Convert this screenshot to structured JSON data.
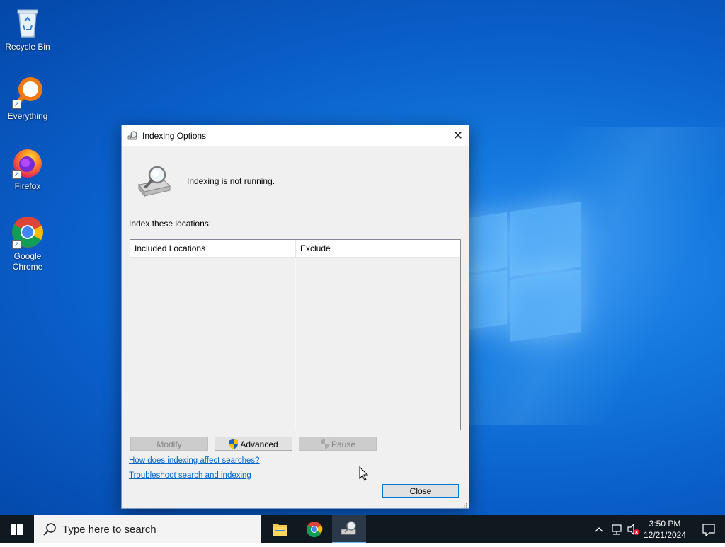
{
  "desktop": {
    "icons": [
      {
        "label": "Recycle Bin"
      },
      {
        "label": "Everything"
      },
      {
        "label": "Firefox"
      },
      {
        "label": "Google Chrome"
      }
    ]
  },
  "dialog": {
    "title": "Indexing Options",
    "status": "Indexing is not running.",
    "index_label": "Index these locations:",
    "columns": [
      "Included Locations",
      "Exclude"
    ],
    "buttons": {
      "modify": "Modify",
      "advanced": "Advanced",
      "pause": "Pause",
      "close": "Close"
    },
    "links": {
      "how": "How does indexing affect searches?",
      "troubleshoot": "Troubleshoot search and indexing"
    }
  },
  "taskbar": {
    "search_placeholder": "Type here to search",
    "time": "3:50 PM",
    "date": "12/21/2024"
  },
  "colors": {
    "accent": "#0078d7",
    "link": "#0066cc",
    "desktop": "#0a5ec9",
    "taskbar": "#101820"
  }
}
